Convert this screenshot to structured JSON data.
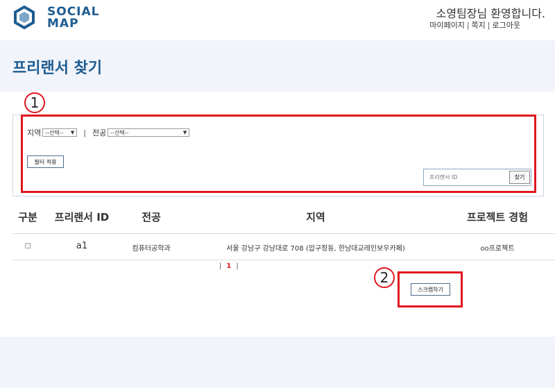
{
  "header": {
    "logo_line1": "SOCIAL",
    "logo_line2": "MAP",
    "welcome": "소영팀장님 환영합니다.",
    "links": [
      "마이페이지",
      "쪽지",
      "로그아웃"
    ],
    "link_separator": "|"
  },
  "page_title": "프리랜서 찾기",
  "filter": {
    "region_label": "지역",
    "region_selected": "--선택--",
    "divider": "|",
    "major_label": "전공",
    "major_selected": "--선택--",
    "apply_label": "필터 적용",
    "search_placeholder": "프리랜서 ID",
    "search_button": "찾기"
  },
  "table": {
    "headers": [
      "구분",
      "프리랜서 ID",
      "전공",
      "지역",
      "프로젝트 경험"
    ],
    "rows": [
      {
        "id": "a1",
        "major": "컴퓨터공학과",
        "region": "서울 강남구 강남대로 708 (압구정동, 한남대교레인보우카페)",
        "project": "oo프로젝트"
      }
    ]
  },
  "pagination": {
    "left": "|",
    "current": "1",
    "right": "|"
  },
  "scrap_button": "스크랩하기",
  "annotations": {
    "one": "1",
    "two": "2",
    "color": "#e0161d"
  },
  "colors": {
    "brand": "#1d5c91",
    "band": "#f2f4fb"
  }
}
